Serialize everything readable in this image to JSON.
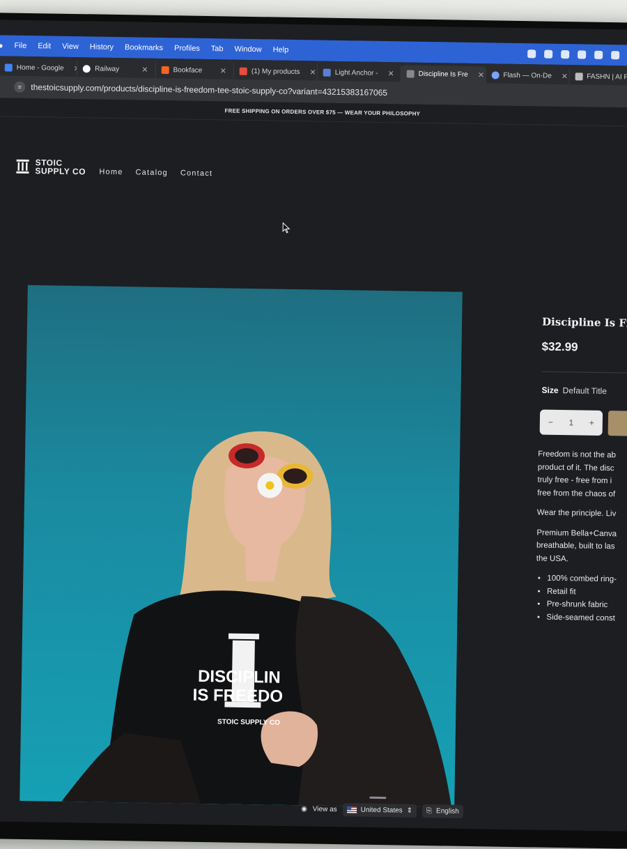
{
  "menubar": {
    "items": [
      "File",
      "Edit",
      "View",
      "History",
      "Bookmarks",
      "Profiles",
      "Tab",
      "Window",
      "Help"
    ]
  },
  "tabs": [
    {
      "label": "Home - Google",
      "color": "#4285f4",
      "active": false
    },
    {
      "label": "Railway",
      "color": "#ffffff",
      "active": false
    },
    {
      "label": "Bookface",
      "color": "#f26522",
      "active": false
    },
    {
      "label": "(1) My products",
      "color": "#e94c3d",
      "active": false
    },
    {
      "label": "Light Anchor -",
      "color": "#5b7fd6",
      "active": false
    },
    {
      "label": "Discipline Is Fre",
      "color": "#888888",
      "active": true
    },
    {
      "label": "Flash — On-De",
      "color": "#7aa2ff",
      "active": false
    },
    {
      "label": "FASHN | AI Fa",
      "color": "#bbbbbb",
      "active": false
    }
  ],
  "url": "thestoicsupply.com/products/discipline-is-freedom-tee-stoic-supply-co?variant=43215383167065",
  "announcement": "FREE SHIPPING ON ORDERS OVER $75 — WEAR YOUR PHILOSOPHY",
  "brand": {
    "line1": "STOIC",
    "line2": "SUPPLY CO"
  },
  "nav": [
    "Home",
    "Catalog",
    "Contact"
  ],
  "product": {
    "title": "Discipline Is Fre",
    "price": "$32.99",
    "size_label": "Size",
    "size_value": "Default Title",
    "quantity": "1",
    "qty_minus": "−",
    "qty_plus": "+",
    "desc_lines": [
      "Freedom is not the ab",
      "product of it. The disc",
      "truly free - free from i",
      "free from the chaos of"
    ],
    "para2": "Wear the principle. Liv",
    "para3_lines": [
      "Premium Bella+Canva",
      "breathable, built to las",
      "the USA."
    ],
    "features": [
      "100% combed ring-",
      "Retail fit",
      "Pre-shrunk fabric",
      "Side-seamed const"
    ]
  },
  "shirt_print": {
    "line1": "DISCIPLIN",
    "line2": "IS FREEDO",
    "line3": "STOIC SUPPLY CO"
  },
  "locale": {
    "view_as": "View as",
    "country": "United States",
    "language": "English"
  },
  "colors": {
    "accent_button": "#a78f6a",
    "page_bg": "#1c1e21",
    "browser_blue": "#2e63d6"
  }
}
